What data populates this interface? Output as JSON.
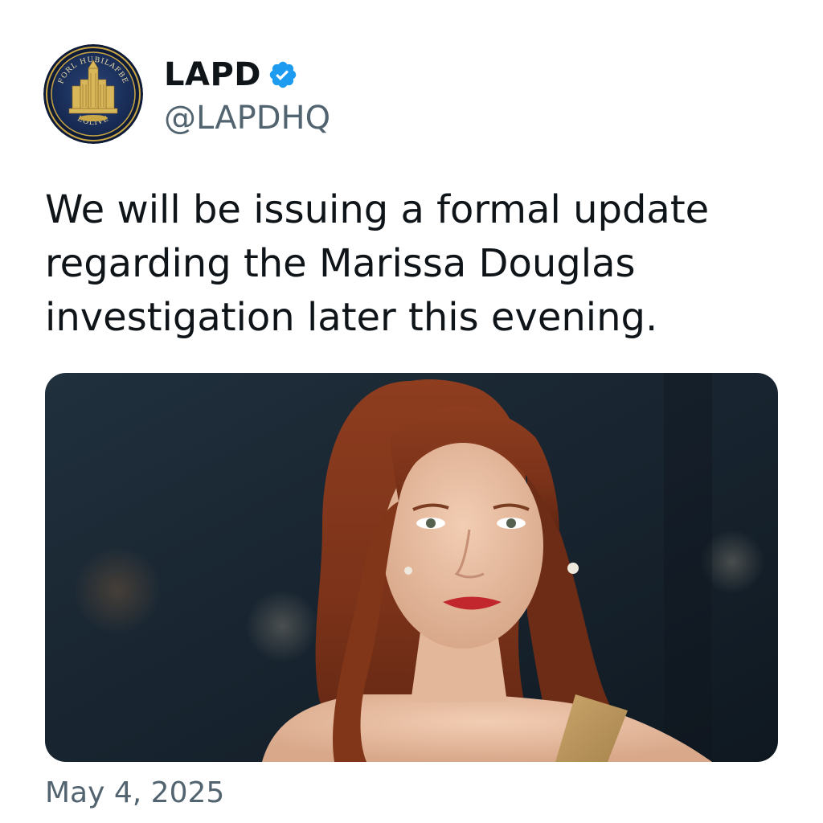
{
  "account": {
    "display_name": "LAPD",
    "handle": "@LAPDHQ",
    "verified": true,
    "avatar_icon": "police-seal-logo",
    "seal_text_top": "FORL HUBILAFBE",
    "seal_text_bottom": "EOLIVE"
  },
  "tweet": {
    "text": "We will be issuing a formal update regarding the Marissa Douglas investigation later this evening.",
    "timestamp": "May 4, 2025"
  },
  "media": {
    "type": "photo",
    "subject": "portrait-photo"
  },
  "colors": {
    "verified_blue": "#1d9bf0",
    "secondary_text": "#536471",
    "primary_text": "#0f1419",
    "seal_navy": "#1b2f5c",
    "seal_gold": "#c9a646",
    "photo_bg": "#1a2631"
  }
}
